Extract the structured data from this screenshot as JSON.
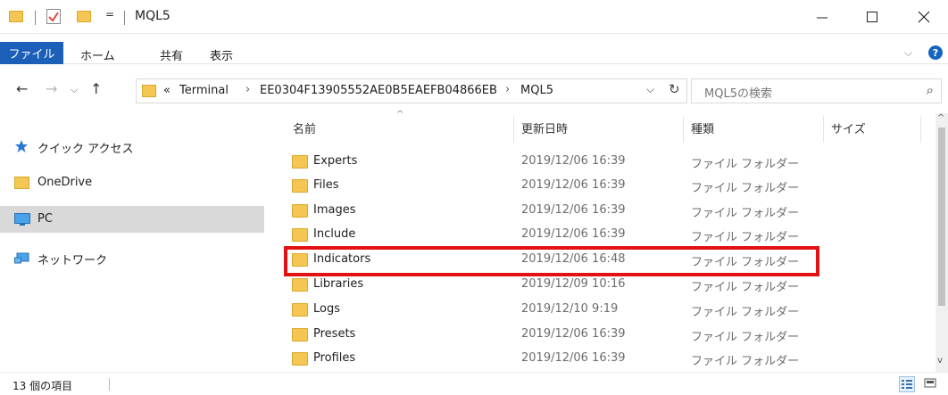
{
  "window": {
    "title": "MQL5",
    "dropdown_glyph": "="
  },
  "ribbon": {
    "file_label": "ファイル",
    "tabs": [
      "ホーム",
      "共有",
      "表示"
    ],
    "help_label": "?"
  },
  "address": {
    "overflow": "«",
    "crumbs": [
      "Terminal",
      "EE0304F13905552AE0B5EAEFB04866EB",
      "MQL5"
    ]
  },
  "search": {
    "placeholder": "MQL5の検索"
  },
  "nav": {
    "items": [
      {
        "label": "クイック アクセス",
        "icon": "star-icon"
      },
      {
        "label": "OneDrive",
        "icon": "folder-icon"
      },
      {
        "label": "PC",
        "icon": "monitor-icon",
        "selected": true
      },
      {
        "label": "ネットワーク",
        "icon": "network-icon"
      }
    ]
  },
  "columns": {
    "name": "名前",
    "date": "更新日時",
    "type": "種類",
    "size": "サイズ"
  },
  "files": [
    {
      "name": "Experts",
      "date": "2019/12/06 16:39",
      "type": "ファイル フォルダー"
    },
    {
      "name": "Files",
      "date": "2019/12/06 16:39",
      "type": "ファイル フォルダー"
    },
    {
      "name": "Images",
      "date": "2019/12/06 16:39",
      "type": "ファイル フォルダー"
    },
    {
      "name": "Include",
      "date": "2019/12/06 16:39",
      "type": "ファイル フォルダー"
    },
    {
      "name": "Indicators",
      "date": "2019/12/06 16:48",
      "type": "ファイル フォルダー",
      "highlighted": true
    },
    {
      "name": "Libraries",
      "date": "2019/12/09 10:16",
      "type": "ファイル フォルダー"
    },
    {
      "name": "Logs",
      "date": "2019/12/10 9:19",
      "type": "ファイル フォルダー"
    },
    {
      "name": "Presets",
      "date": "2019/12/06 16:39",
      "type": "ファイル フォルダー"
    },
    {
      "name": "Profiles",
      "date": "2019/12/06 16:39",
      "type": "ファイル フォルダー"
    }
  ],
  "status": {
    "item_count": "13 個の項目"
  },
  "colors": {
    "accent": "#1b5fb8",
    "highlight": "#e21212",
    "folder": "#f4c654",
    "selected_bg": "#d9d9d9"
  }
}
